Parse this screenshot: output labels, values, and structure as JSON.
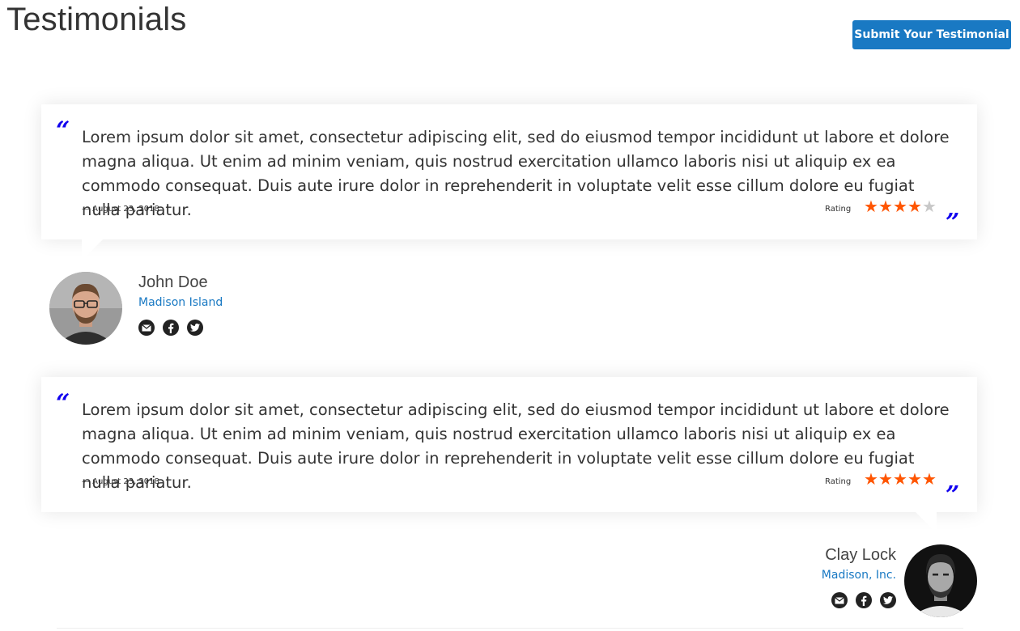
{
  "page": {
    "title": "Testimonials",
    "submit_label": "Submit Your Testimonial",
    "accent_color": "#1979c3",
    "quote_color": "#1100ee",
    "star_color": "#ff5501"
  },
  "testimonials": [
    {
      "text": "Lorem ipsum dolor sit amet, consectetur adipiscing elit, sed do eiusmod tempor incididunt ut labore et dolore magna aliqua. Ut enim ad minim veniam, quis nostrud exercitation ullamco laboris nisi ut aliquip ex ea commodo consequat. Duis aute irure dolor in reprehenderit in voluptate velit esse cillum dolore eu fugiat nulla pariatur.",
      "date": "— August 23, 2018",
      "rating_label": "Rating",
      "rating": 4,
      "rating_max": 5,
      "name": "John Doe",
      "company": "Madison Island",
      "socials": [
        "email-icon",
        "facebook-icon",
        "twitter-icon"
      ]
    },
    {
      "text": "Lorem ipsum dolor sit amet, consectetur adipiscing elit, sed do eiusmod tempor incididunt ut labore et dolore magna aliqua. Ut enim ad minim veniam, quis nostrud exercitation ullamco laboris nisi ut aliquip ex ea commodo consequat. Duis aute irure dolor in reprehenderit in voluptate velit esse cillum dolore eu fugiat nulla pariatur.",
      "date": "— August 23, 2018",
      "rating_label": "Rating",
      "rating": 5,
      "rating_max": 5,
      "name": "Clay Lock",
      "company": "Madison, Inc.",
      "socials": [
        "email-icon",
        "facebook-icon",
        "twitter-icon"
      ]
    }
  ]
}
